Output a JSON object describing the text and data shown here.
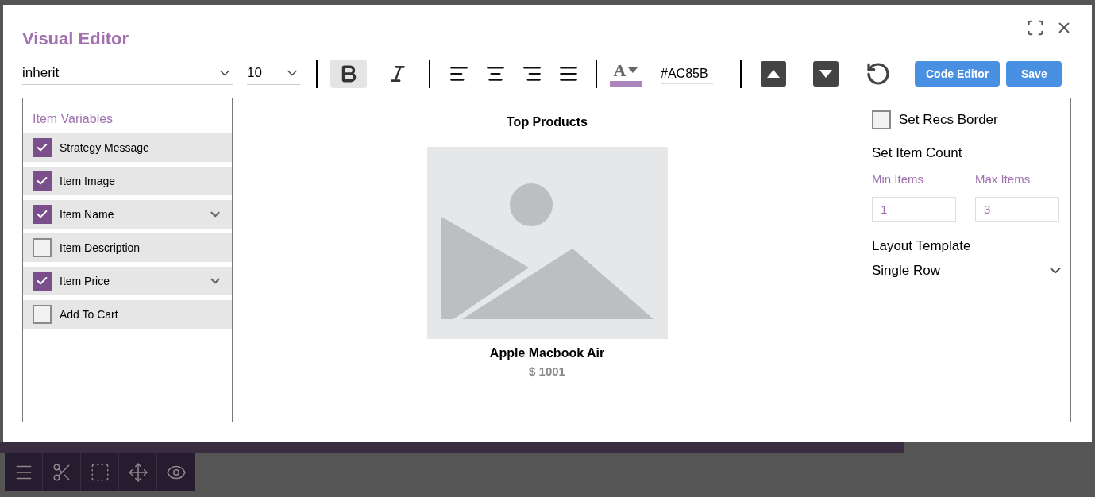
{
  "window": {
    "title": "Visual Editor"
  },
  "toolbar": {
    "font_family": "inherit",
    "font_size": "10",
    "format_buttons": [
      {
        "kind": "bold",
        "selected": true
      },
      {
        "kind": "italic",
        "selected": false
      }
    ],
    "align_buttons": [
      {
        "kind": "left",
        "selected": false
      },
      {
        "kind": "center",
        "selected": false
      },
      {
        "kind": "right",
        "selected": false
      },
      {
        "kind": "justify",
        "selected": false
      }
    ],
    "text_color": {
      "letter": "A",
      "color": "#ac85bc",
      "value": "#AC85B"
    },
    "buttons": [
      "Code Editor",
      "Save"
    ]
  },
  "variables": {
    "title": "Item Variables",
    "items": [
      {
        "label": "Strategy Message",
        "checked": true,
        "expandable": false
      },
      {
        "label": "Item Image",
        "checked": true,
        "expandable": false
      },
      {
        "label": "Item Name",
        "checked": true,
        "expandable": true
      },
      {
        "label": "Item Description",
        "checked": false,
        "expandable": false
      },
      {
        "label": "Item Price",
        "checked": true,
        "expandable": true
      },
      {
        "label": "Add To Cart",
        "checked": false,
        "expandable": false
      }
    ]
  },
  "preview": {
    "heading": "Top Products",
    "product_name": "Apple Macbook Air",
    "price": "$ 1001"
  },
  "settings": {
    "recs_border": {
      "label": "Set Recs Border",
      "checked": false
    },
    "item_count_title": "Set Item Count",
    "min": {
      "label": "Min Items",
      "value": "1"
    },
    "max": {
      "label": "Max Items",
      "value": "3"
    },
    "layout_title": "Layout Template",
    "layout_value": "Single Row"
  },
  "bottom_toolbar": [
    {
      "kind": "menu"
    },
    {
      "kind": "cut"
    },
    {
      "kind": "select"
    },
    {
      "kind": "move"
    },
    {
      "kind": "preview"
    }
  ]
}
